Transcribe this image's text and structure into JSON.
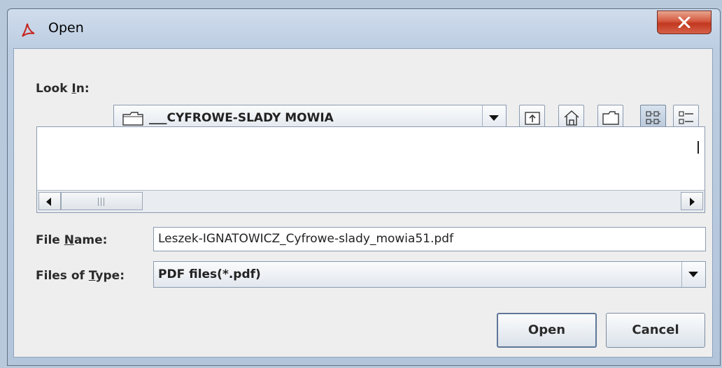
{
  "window": {
    "title": "Open",
    "close_symbol": "X"
  },
  "look_in": {
    "label_prefix": "Look ",
    "label_mnemonic": "I",
    "label_suffix": "n:",
    "value": "___CYFROWE-SLADY MOWIA",
    "folder_icon": "folder-icon"
  },
  "toolbar": {
    "buttons": [
      {
        "name": "up-one-level",
        "icon": "up-folder-icon"
      },
      {
        "name": "home",
        "icon": "home-icon"
      },
      {
        "name": "new-folder",
        "icon": "new-folder-icon"
      },
      {
        "name": "list-view",
        "icon": "list-view-icon",
        "selected": true
      },
      {
        "name": "details-view",
        "icon": "details-view-icon"
      }
    ]
  },
  "file_name": {
    "label_prefix": "File ",
    "label_mnemonic": "N",
    "label_suffix": "ame:",
    "value": "Leszek-IGNATOWICZ_Cyfrowe-slady_mowia51.pdf"
  },
  "files_of_type": {
    "label_prefix": "Files of ",
    "label_mnemonic": "T",
    "label_suffix": "ype:",
    "value": "PDF files(*.pdf)"
  },
  "buttons": {
    "open": "Open",
    "cancel": "Cancel"
  },
  "colors": {
    "accent_close": "#c2371f",
    "panel_bg": "#eeeeee"
  }
}
